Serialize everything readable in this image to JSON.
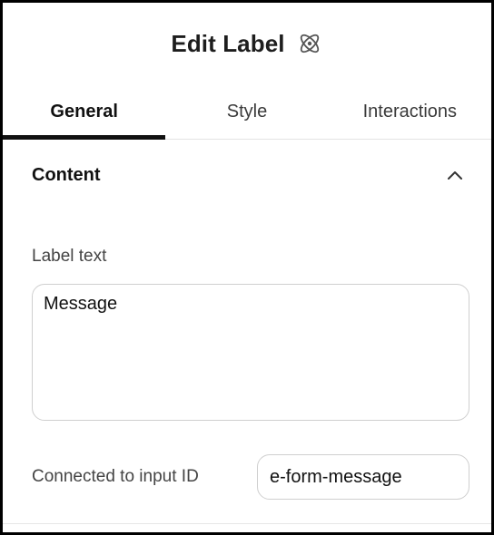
{
  "header": {
    "title": "Edit Label",
    "icon": "atom-icon"
  },
  "tabs": [
    {
      "label": "General",
      "active": true
    },
    {
      "label": "Style",
      "active": false
    },
    {
      "label": "Interactions",
      "active": false
    }
  ],
  "section": {
    "title": "Content",
    "toggle_icon": "chevron-up-icon",
    "expanded": true
  },
  "fields": {
    "label_text": {
      "label": "Label text",
      "value": "Message"
    },
    "input_id": {
      "label": "Connected to input ID",
      "value": "e-form-message"
    }
  },
  "colors": {
    "accent": "#111111",
    "border": "#cfcfcf"
  }
}
